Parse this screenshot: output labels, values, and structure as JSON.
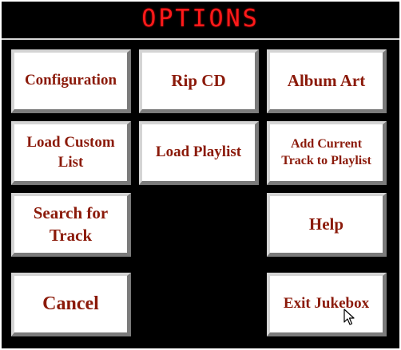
{
  "window": {
    "title": "OPTIONS"
  },
  "buttons": {
    "configuration": "Configuration",
    "rip_cd": "Rip CD",
    "album_art": "Album Art",
    "load_custom_list": "Load Custom List",
    "load_playlist": "Load Playlist",
    "add_current_track": "Add Current Track to Playlist",
    "search_for_track": "Search for Track",
    "help": "Help",
    "cancel": "Cancel",
    "exit_jukebox": "Exit Jukebox"
  },
  "colors": {
    "background": "#000000",
    "title_text": "#ff1a1a",
    "button_face": "#ffffff",
    "button_text": "#8b1a0a"
  },
  "icons": {
    "cursor": "arrow-cursor-icon"
  }
}
